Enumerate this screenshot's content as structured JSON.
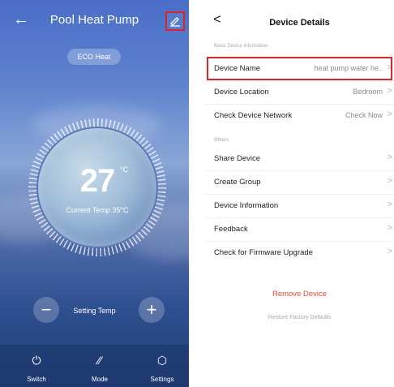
{
  "left_panel": {
    "title": "Pool Heat Pump",
    "mode_pill": "ECO Heat",
    "temperature": "27",
    "temperature_unit": "°C",
    "current_temp": "Current Temp 35°C",
    "setting_label": "Setting Temp",
    "minus_label": "−",
    "plus_label": "+",
    "nav": [
      {
        "label": "Switch",
        "icon": "power-icon",
        "glyph": "⏻"
      },
      {
        "label": "Mode",
        "icon": "mode-icon",
        "glyph": "⁄⁄"
      },
      {
        "label": "Settings",
        "icon": "settings-icon",
        "glyph": "⬡"
      }
    ]
  },
  "right_panel": {
    "back": "<",
    "title": "Device Details",
    "section_basic": "Basic Device Information",
    "rows_basic": [
      {
        "label": "Device Name",
        "value": "heat pump water he..",
        "chevron": ">"
      },
      {
        "label": "Device Location",
        "value": "Bedroom",
        "chevron": ">"
      },
      {
        "label": "Check Device Network",
        "value": "Check Now",
        "chevron": ">"
      }
    ],
    "section_others": "Others",
    "rows_others": [
      {
        "label": "Share Device",
        "chevron": ">"
      },
      {
        "label": "Create Group",
        "chevron": ">"
      },
      {
        "label": "Device Information",
        "chevron": ">"
      },
      {
        "label": "Feedback",
        "chevron": ">"
      },
      {
        "label": "Check for Firmware Upgrade",
        "chevron": ">"
      }
    ],
    "remove_device": "Remove Device",
    "restore_defaults": "Restore Factory Defaults"
  },
  "colors": {
    "highlight_red": "#d62828",
    "remove_red": "#e24c3c"
  }
}
